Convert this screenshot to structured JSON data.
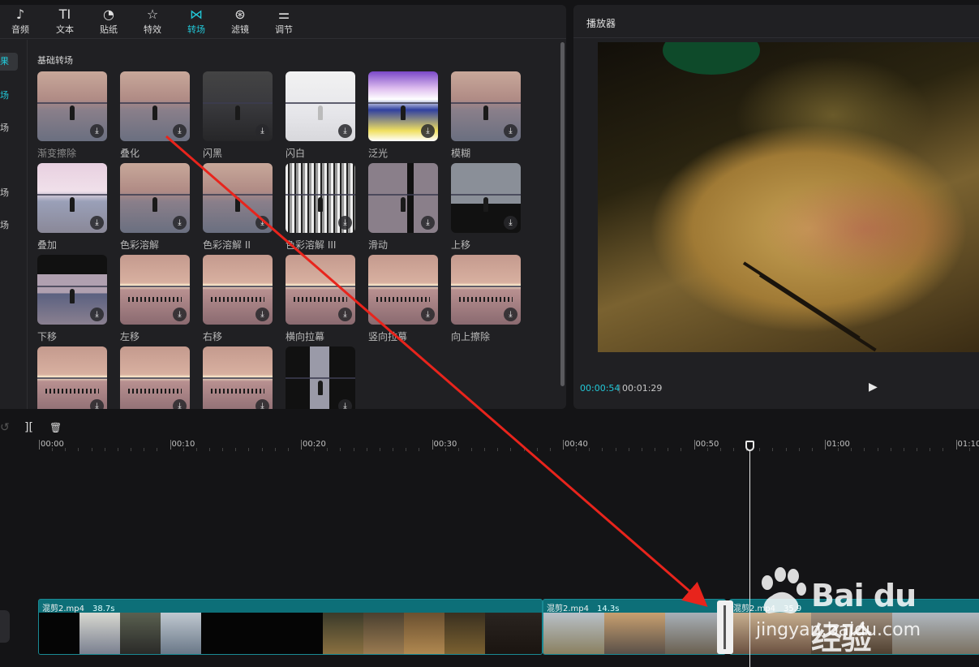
{
  "toolbar": {
    "tabs": [
      {
        "icon": "♪",
        "label": "音频"
      },
      {
        "icon": "TI",
        "label": "文本"
      },
      {
        "icon": "◔",
        "label": "贴纸"
      },
      {
        "icon": "☆",
        "label": "特效"
      },
      {
        "icon": "⋈",
        "label": "转场"
      },
      {
        "icon": "⊛",
        "label": "滤镜"
      },
      {
        "icon": "⚌",
        "label": "调节"
      }
    ],
    "active_tab": "转场"
  },
  "categories": [
    "果",
    "场",
    "场",
    "",
    "场",
    "场"
  ],
  "section_title": "基础转场",
  "transitions": [
    {
      "name": "渐变擦除",
      "thumb": "first"
    },
    {
      "name": "叠化",
      "thumb": ""
    },
    {
      "name": "闪黑",
      "thumb": "dark"
    },
    {
      "name": "闪白",
      "thumb": "white"
    },
    {
      "name": "泛光",
      "thumb": "glow"
    },
    {
      "name": "模糊",
      "thumb": ""
    },
    {
      "name": "叠加",
      "thumb": "pink"
    },
    {
      "name": "色彩溶解",
      "thumb": ""
    },
    {
      "name": "色彩溶解 II",
      "thumb": ""
    },
    {
      "name": "色彩溶解 III",
      "thumb": "noise"
    },
    {
      "name": "滑动",
      "thumb": "split"
    },
    {
      "name": "上移",
      "thumb": "upmove"
    },
    {
      "name": "下移",
      "thumb": "downmove"
    },
    {
      "name": "左移",
      "thumb": "sunset"
    },
    {
      "name": "右移",
      "thumb": "sunset"
    },
    {
      "name": "横向拉幕",
      "thumb": "sunset"
    },
    {
      "name": "竖向拉幕",
      "thumb": "sunset"
    },
    {
      "name": "向上擦除",
      "thumb": "sunset"
    },
    {
      "name": "",
      "thumb": "sunset"
    },
    {
      "name": "",
      "thumb": "sunset"
    },
    {
      "name": "",
      "thumb": "sunset"
    },
    {
      "name": "",
      "thumb": "blackside"
    }
  ],
  "download_icon": "⤓",
  "player": {
    "title": "播放器",
    "current_time": "00:00:54",
    "separator": "|",
    "total_time": "00:01:29",
    "play_icon": "▶"
  },
  "timeline": {
    "undo_icon": "↺",
    "split_icon": "][",
    "delete_icon": "🗑",
    "ticks": [
      "00:00",
      "00:10",
      "00:20",
      "00:30",
      "00:40",
      "00:50",
      "01:00",
      "01:10"
    ],
    "clips": [
      {
        "name": "混剪2.mp4",
        "duration": "38.7s"
      },
      {
        "name": "混剪2.mp4",
        "duration": "14.3s"
      },
      {
        "name": "混剪2.mp4",
        "duration": "35.9"
      }
    ]
  },
  "watermark": {
    "brand": "Bai du 经验",
    "url": "jingyan.baidu.com"
  },
  "colors": {
    "accent": "#22c8d8",
    "track": "#0d6f78",
    "arrow": "#e8241c"
  }
}
